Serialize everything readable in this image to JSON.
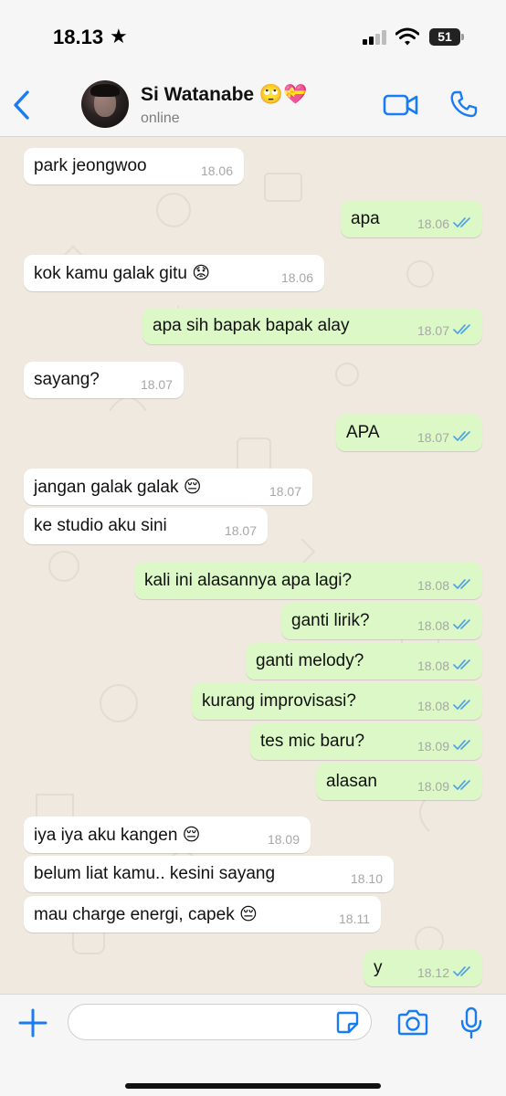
{
  "status_bar": {
    "time": "18.13",
    "star": "★",
    "battery": "51"
  },
  "header": {
    "contact_name": "Si Watanabe 🙄💝",
    "status": "online"
  },
  "messages": [
    {
      "dir": "in",
      "text": "park jeongwoo",
      "time": "18.06"
    },
    {
      "dir": "out",
      "text": "apa",
      "time": "18.06",
      "read": true
    },
    {
      "dir": "in",
      "text": "kok kamu galak gitu 😟",
      "time": "18.06"
    },
    {
      "dir": "out",
      "text": "apa sih bapak bapak alay",
      "time": "18.07",
      "read": true
    },
    {
      "dir": "in",
      "text": "sayang?",
      "time": "18.07"
    },
    {
      "dir": "out",
      "text": "APA",
      "time": "18.07",
      "read": true
    },
    {
      "dir": "in",
      "text": "jangan galak galak 😔",
      "time": "18.07"
    },
    {
      "dir": "in",
      "text": "ke studio aku sini",
      "time": "18.07"
    },
    {
      "dir": "out",
      "text": "kali ini alasannya apa lagi?",
      "time": "18.08",
      "read": true
    },
    {
      "dir": "out",
      "text": "ganti lirik?",
      "time": "18.08",
      "read": true
    },
    {
      "dir": "out",
      "text": "ganti melody?",
      "time": "18.08",
      "read": true
    },
    {
      "dir": "out",
      "text": "kurang improvisasi?",
      "time": "18.08",
      "read": true
    },
    {
      "dir": "out",
      "text": "tes mic baru?",
      "time": "18.09",
      "read": true
    },
    {
      "dir": "out",
      "text": "alasan",
      "time": "18.09",
      "read": true
    },
    {
      "dir": "in",
      "text": "iya iya aku kangen 😔",
      "time": "18.09"
    },
    {
      "dir": "in",
      "text": "belum liat kamu.. kesini sayang",
      "time": "18.10"
    },
    {
      "dir": "in",
      "text": "mau charge energi, capek 😔",
      "time": "18.11"
    },
    {
      "dir": "out",
      "text": "y",
      "time": "18.12",
      "read": true
    }
  ],
  "input": {
    "placeholder": "",
    "value": ""
  },
  "icons": {
    "back": "chevron-left-icon",
    "video": "video-camera-icon",
    "call": "phone-icon",
    "plus": "plus-icon",
    "sticker": "sticker-icon",
    "camera": "camera-icon",
    "mic": "microphone-icon"
  },
  "colors": {
    "accent": "#1a7cf3",
    "outgoing_bubble": "#dcf8c6",
    "incoming_bubble": "#ffffff",
    "chat_background": "#efe9df",
    "read_ticks": "#4fa3e8"
  }
}
